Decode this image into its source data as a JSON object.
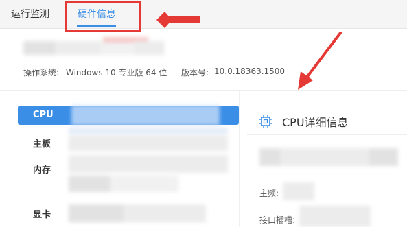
{
  "tabs": [
    {
      "label": "运行监测",
      "active": false
    },
    {
      "label": "硬件信息",
      "active": true
    }
  ],
  "system": {
    "os_label": "操作系统:",
    "os_value": "Windows 10 专业版 64 位",
    "version_label": "版本号:",
    "version_value": "10.0.18363.1500"
  },
  "sidebar": {
    "items": [
      {
        "label": "CPU",
        "active": true
      },
      {
        "label": "主板",
        "active": false
      },
      {
        "label": "内存",
        "active": false
      },
      {
        "label": "显卡",
        "active": false
      }
    ]
  },
  "detail": {
    "title": "CPU详细信息",
    "fields": [
      {
        "label": "主频:"
      },
      {
        "label": "接口插槽:"
      }
    ]
  },
  "colors": {
    "accent": "#3a8ee6",
    "annotation": "#e53935"
  },
  "icons": {
    "detail_icon": "cpu-chip-icon"
  }
}
